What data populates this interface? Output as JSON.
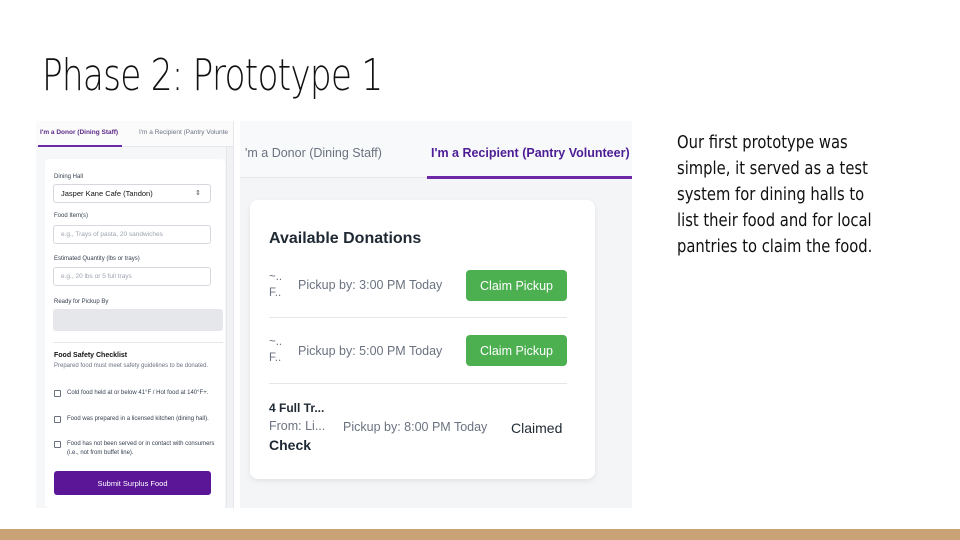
{
  "slide": {
    "title": "Phase 2: Prototype 1",
    "body_lines": [
      "Our first prototype was",
      "simple, it served as a test",
      "system for dining halls to",
      "list their food and for local",
      "pantries to claim the food."
    ],
    "accent_color": "#c9a375"
  },
  "donor_view": {
    "tabs": [
      "I'm a Donor (Dining Staff)",
      "I'm a Recipient (Pantry Volunte"
    ],
    "dining_hall_label": "Dining Hall",
    "dining_hall_value": "Jasper Kane Cafe (Tandon)",
    "food_items_label": "Food Item(s)",
    "food_items_placeholder": "e.g., Trays of pasta, 20 sandwiches",
    "quantity_label": "Estimated Quantity (lbs or trays)",
    "quantity_placeholder": "e.g., 20 lbs or 5 full trays",
    "pickup_by_label": "Ready for Pickup By",
    "checklist_title": "Food Safety Checklist",
    "checklist_desc": "Prepared food must meet safety guidelines to be donated.",
    "checklist_items": [
      "Cold food held at or below 41°F / Hot food at 140°F+.",
      "Food was prepared in a licensed kitchen (dining hall).",
      "Food has not been served or in contact with consumers (i.e., not from buffet line)."
    ],
    "submit_label": "Submit Surplus Food",
    "brand_color": "#5b1597"
  },
  "recipient_view": {
    "tabs": [
      "'m a Donor (Dining Staff)",
      "I'm a Recipient (Pantry Volunteer)"
    ],
    "card_title": "Available Donations",
    "donations": [
      {
        "name_line1": "~..",
        "name_line2": "F..",
        "pickup": "Pickup by: 3:00 PM Today",
        "action": "Claim Pickup"
      },
      {
        "name_line1": "~..",
        "name_line2": "F..",
        "pickup": "Pickup by: 5:00 PM Today",
        "action": "Claim Pickup"
      },
      {
        "name_line1": "4 Full Tr...",
        "name_line2": "From: Li...",
        "name_line3": "Check",
        "pickup": "Pickup by: 8:00 PM Today",
        "status": "Claimed"
      }
    ],
    "claim_color": "#4caf50",
    "tab_accent": "#6d28a8"
  }
}
